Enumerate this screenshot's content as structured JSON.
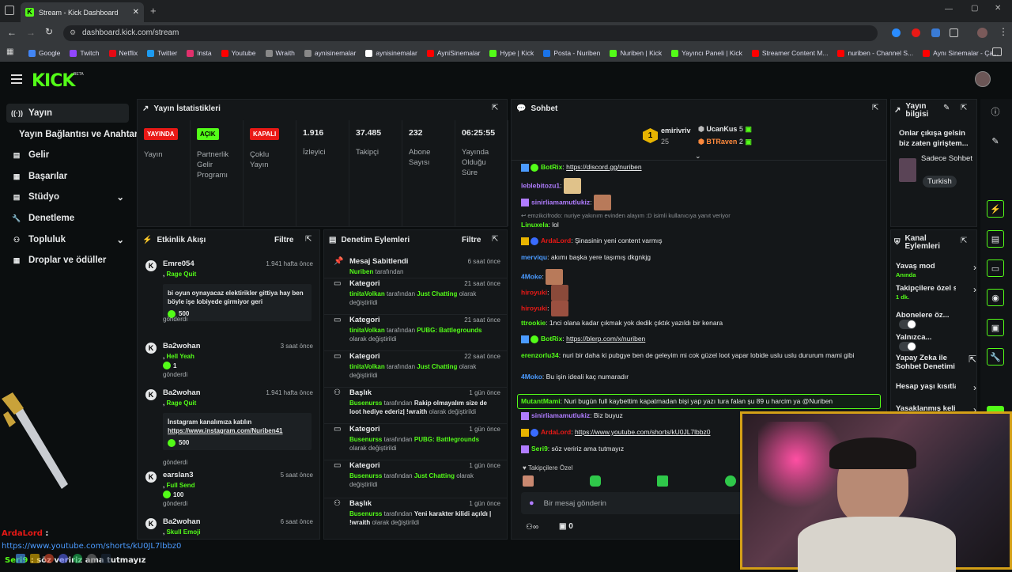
{
  "browser": {
    "tab_title": "Stream - Kick Dashboard",
    "url": "dashboard.kick.com/stream",
    "bookmarks": [
      {
        "label": "Google",
        "color": "#4285f4"
      },
      {
        "label": "Twitch",
        "color": "#9146ff"
      },
      {
        "label": "Netflix",
        "color": "#e50914"
      },
      {
        "label": "Twitter",
        "color": "#1d9bf0"
      },
      {
        "label": "Insta",
        "color": "#e1306c"
      },
      {
        "label": "Youtube",
        "color": "#ff0000"
      },
      {
        "label": "Wraith",
        "color": "#888888"
      },
      {
        "label": "aynisinemalar",
        "color": "#888888"
      },
      {
        "label": "aynisinemalar",
        "color": "#ffffff"
      },
      {
        "label": "AyniSinemalar",
        "color": "#ff0000"
      },
      {
        "label": "Hype | Kick",
        "color": "#53fc18"
      },
      {
        "label": "Posta - Nuriben",
        "color": "#1a73e8"
      },
      {
        "label": "Nuriben | Kick",
        "color": "#53fc18"
      },
      {
        "label": "Yayıncı Paneli | Kick",
        "color": "#53fc18"
      },
      {
        "label": "Streamer Content M...",
        "color": "#ff0000"
      },
      {
        "label": "nuriben - Channel S...",
        "color": "#ff0000"
      },
      {
        "label": "Aynı Sinemalar - Ça...",
        "color": "#ff0000"
      }
    ]
  },
  "sidebar": {
    "items": [
      {
        "label": "Yayın",
        "icon": "broadcast-icon"
      },
      {
        "label": "Yayın Bağlantısı ve Anahtarı",
        "icon": ""
      },
      {
        "label": "Gelir",
        "icon": "revenue-icon"
      },
      {
        "label": "Başarılar",
        "icon": "achievements-icon"
      },
      {
        "label": "Stüdyo",
        "icon": "studio-icon"
      },
      {
        "label": "Denetleme",
        "icon": "wrench-icon"
      },
      {
        "label": "Topluluk",
        "icon": "community-icon"
      },
      {
        "label": "Droplar ve ödüller",
        "icon": "drops-icon"
      }
    ]
  },
  "stats": {
    "title": "Yayın İstatistikleri",
    "items": [
      {
        "badge": "YAYINDA",
        "badge_bg": "#e91916",
        "badge_fg": "#ffffff",
        "label": "Yayın"
      },
      {
        "badge": "AÇIK",
        "badge_bg": "#53fc18",
        "badge_fg": "#000000",
        "label": "Partnerlik Gelir Programı"
      },
      {
        "badge": "KAPALI",
        "badge_bg": "#e91916",
        "badge_fg": "#ffffff",
        "label": "Çoklu Yayın"
      },
      {
        "value": "1.916",
        "label": "İzleyici"
      },
      {
        "value": "37.485",
        "label": "Takipçi"
      },
      {
        "value": "232",
        "label": "Abone Sayısı"
      },
      {
        "value": "06:25:55",
        "label": "Yayında Olduğu Süre"
      }
    ]
  },
  "activity": {
    "title": "Etkinlik Akışı",
    "filter": "Filtre",
    "items": [
      {
        "user": "Emre054",
        "time": "1.941 hafta önce",
        "reward": "Rage Quit",
        "message": "bi oyun oynayacaz elektirikler gittiya hay ben böyle işe lobiyede girmiyor geri",
        "amount": "500",
        "sent": "gönderdi"
      },
      {
        "user": "Ba2wohan",
        "time": "3 saat önce",
        "reward": "Hell Yeah",
        "amount": "1",
        "sent": "gönderdi"
      },
      {
        "user": "Ba2wohan",
        "time": "1.941 hafta önce",
        "reward": "Rage Quit",
        "message": "İnstagram kanalımıza katılın",
        "message_link": "https://www.instagram.com/Nuriben41",
        "amount": "500",
        "sent": "gönderdi"
      },
      {
        "user": "earslan3",
        "time": "5 saat önce",
        "reward": "Full Send",
        "amount": "100",
        "sent": "gönderdi"
      },
      {
        "user": "Ba2wohan",
        "time": "6 saat önce",
        "reward": "Skull Emoji"
      }
    ]
  },
  "moderation": {
    "title": "Denetim Eylemleri",
    "filter": "Filtre",
    "items": [
      {
        "title": "Mesaj Sabitlendi",
        "time": "6 saat önce",
        "user": "Nuriben",
        "suffix": "tarafından"
      },
      {
        "title": "Kategori",
        "time": "21 saat önce",
        "user": "tinitaVolkan",
        "mid": "tarafından",
        "value": "Just Chatting",
        "end": "olarak değiştirildi"
      },
      {
        "title": "Kategori",
        "time": "21 saat önce",
        "user": "tinitaVolkan",
        "mid": "tarafından",
        "value": "PUBG: Battlegrounds",
        "end": "olarak değiştirildi"
      },
      {
        "title": "Kategori",
        "time": "22 saat önce",
        "user": "tinitaVolkan",
        "mid": "tarafından",
        "value": "Just Chatting",
        "end": "olarak değiştirildi"
      },
      {
        "title": "Başlık",
        "time": "1 gün önce",
        "user": "Busenurss",
        "mid": "tarafından",
        "value": "Rakip olmayalım size de loot hediye ederiz| !wraith",
        "end": "olarak değiştirildi"
      },
      {
        "title": "Kategori",
        "time": "1 gün önce",
        "user": "Busenurss",
        "mid": "tarafından",
        "value": "PUBG: Battlegrounds",
        "end": "olarak değiştirildi"
      },
      {
        "title": "Kategori",
        "time": "1 gün önce",
        "user": "Busenurss",
        "mid": "tarafından",
        "value": "Just Chatting",
        "end": "olarak değiştirildi"
      },
      {
        "title": "Başlık",
        "time": "1 gün önce",
        "user": "Busenurss",
        "mid": "tarafından",
        "value": "Yeni karakter kilidi açıldı | !wraith",
        "end": "olarak değiştirildi"
      }
    ]
  },
  "chat": {
    "title": "Sohbet",
    "top_gifter": {
      "name": "emirivriv",
      "count": "25",
      "rank": "1"
    },
    "gifters": [
      {
        "name": "UcanKus",
        "count": "5"
      },
      {
        "name": "BTRaven",
        "count": "2"
      }
    ],
    "messages": [
      {
        "user": "BotRix",
        "color": "#53fc18",
        "text": "https://discord.gg/nuriben",
        "link": true
      },
      {
        "user": "leblebitozu1",
        "color": "#b07cff",
        "emote": true
      },
      {
        "user": "sinirliamamutlukiz",
        "color": "#b07cff",
        "emote": true
      },
      {
        "reply": "emzikcifrodo: nuriye yakınım evinden alayım :D isimli kullanıcıya yanıt veriyor"
      },
      {
        "user": "Linuxela",
        "color": "#53fc18",
        "text": "lol"
      },
      {
        "user": "ArdaLord",
        "color": "#e91916",
        "text": "Şinasinin yeni content varmış"
      },
      {
        "user": "merviqu",
        "color": "#4b9bff",
        "text": "akımı başka yere taşımış dkgnkjg"
      },
      {
        "user": "4Moke",
        "color": "#4b9bff",
        "emote": true
      },
      {
        "user": "hiroyuki",
        "color": "#e91916",
        "emote": true
      },
      {
        "user": "hiroyuki",
        "color": "#e91916",
        "emote": true
      },
      {
        "user": "ttrookie",
        "color": "#53fc18",
        "text": "1nci olana kadar çıkmak yok dedik çıktık yazıldı bir kenara"
      },
      {
        "user": "BotRix",
        "color": "#53fc18",
        "text": "https://blerp.com/x/nuriben",
        "link": true
      },
      {
        "user": "erenzorlu34",
        "color": "#53fc18",
        "text": "nuri bir daha ki pubgye ben de geleyim mi cok güzel loot yapar lobide uslu uslu dururum mami gibi"
      },
      {
        "user": "4Moko",
        "color": "#4b9bff",
        "text": "Bu işin ideali kaç numaradır"
      },
      {
        "user": "MutantMami",
        "color": "#53fc18",
        "text": "Nuri bugün full kaybettim kapatmadan bişi yap yazı tura falan şu 89 u harcim ya @Nuriben",
        "highlight": true
      },
      {
        "user": "sinirliamamutlukiz",
        "color": "#b07cff",
        "text": "Biz buyuz"
      },
      {
        "user": "ArdaLord",
        "color": "#e91916",
        "text": "https://www.youtube.com/shorts/kU0JL7lbbz0",
        "link": true
      },
      {
        "user": "Seri9",
        "color": "#53fc18",
        "text": "söz veririz ama tutmayız"
      }
    ],
    "followers_only": "Takipçilere Özel",
    "input_placeholder": "Bir mesaj gönderin",
    "counter": "0"
  },
  "stream_info": {
    "title": "Yayın bilgisi",
    "text": "Onlar çıkışa gelsin biz zaten giriştem...",
    "lang_mode": "Sadece Sohbet",
    "language": "Turkish"
  },
  "channel_actions": {
    "title": "Kanal Eylemleri",
    "items": [
      {
        "label": "Yavaş mod",
        "sub": "Anında",
        "control": "chevron"
      },
      {
        "label": "Takipçilere özel s",
        "sub": "1 dk.",
        "control": "chevron"
      },
      {
        "label": "Abonelere öz...",
        "control": "toggle"
      },
      {
        "label": "Yalnızca...",
        "control": "toggle"
      },
      {
        "label": "Yapay Zeka ile Sohbet Denetimi",
        "control": "external"
      },
      {
        "label": "Hesap yaşı kısıtla",
        "control": "chevron"
      },
      {
        "label": "Yasaklanmış kelin",
        "control": "chevron"
      }
    ]
  },
  "overlay": {
    "user": "ArdaLord",
    "link": "https://www.youtube.com/shorts/kU0JL7lbbz0",
    "user2": "Seri9",
    "text2": "söz veririz ama tutmayız"
  },
  "colors": {
    "accent": "#53fc18",
    "live": "#e91916",
    "panel": "#141719",
    "webcam_border": "#d4a017"
  }
}
